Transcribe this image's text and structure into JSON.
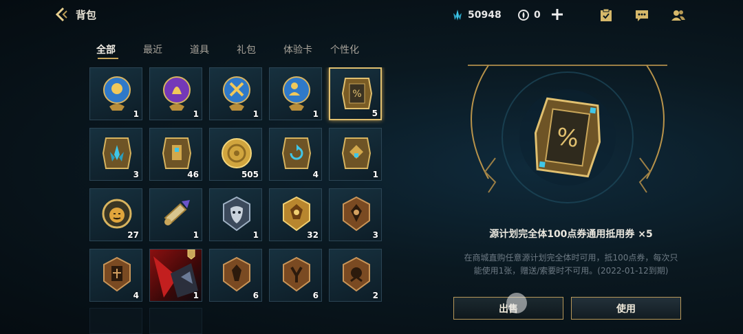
{
  "header": {
    "title": "背包",
    "blue_essence": "50948",
    "orange_essence": "0"
  },
  "tabs": [
    "全部",
    "最近",
    "道具",
    "礼包",
    "体验卡",
    "个性化"
  ],
  "items": [
    {
      "icon": "blue-orb-icon",
      "count": "1"
    },
    {
      "icon": "purple-orb-icon",
      "count": "1"
    },
    {
      "icon": "crossed-swords-orb-icon",
      "count": "1"
    },
    {
      "icon": "champion-orb-icon",
      "count": "1"
    },
    {
      "icon": "discount-coupon-icon",
      "count": "5"
    },
    {
      "icon": "teal-card-icon",
      "count": "3"
    },
    {
      "icon": "gold-card-icon",
      "count": "46"
    },
    {
      "icon": "gold-coin-icon",
      "count": "505"
    },
    {
      "icon": "refresh-card-icon",
      "count": "4"
    },
    {
      "icon": "diamond-card-icon",
      "count": "1"
    },
    {
      "icon": "pumpkin-token-icon",
      "count": "27"
    },
    {
      "icon": "scroll-icon",
      "count": "1"
    },
    {
      "icon": "mask-emblem-icon",
      "count": "1"
    },
    {
      "icon": "gold-emblem-icon",
      "count": "32"
    },
    {
      "icon": "bronze-emblem-icon",
      "count": "3"
    },
    {
      "icon": "shield-emblem-icon",
      "count": "4"
    },
    {
      "icon": "skin-portrait-icon",
      "count": "1"
    },
    {
      "icon": "bronze-emblem-icon",
      "count": "6"
    },
    {
      "icon": "bronze-emblem-icon",
      "count": "6"
    },
    {
      "icon": "bronze-emblem-icon",
      "count": "2"
    }
  ],
  "detail": {
    "name": "源计划完全体100点券通用抵用券 ×5",
    "desc_line1": "在商城直购任意源计划完全体时可用，抵100点券，每次只",
    "desc_line2": "能使用1张，赠送/索要时不可用。(2022-01-12到期)"
  },
  "buttons": {
    "sell": "出售",
    "use": "使用"
  },
  "colors": {
    "accent_gold": "#c9a65a",
    "essence_blue": "#3fc6e8"
  }
}
